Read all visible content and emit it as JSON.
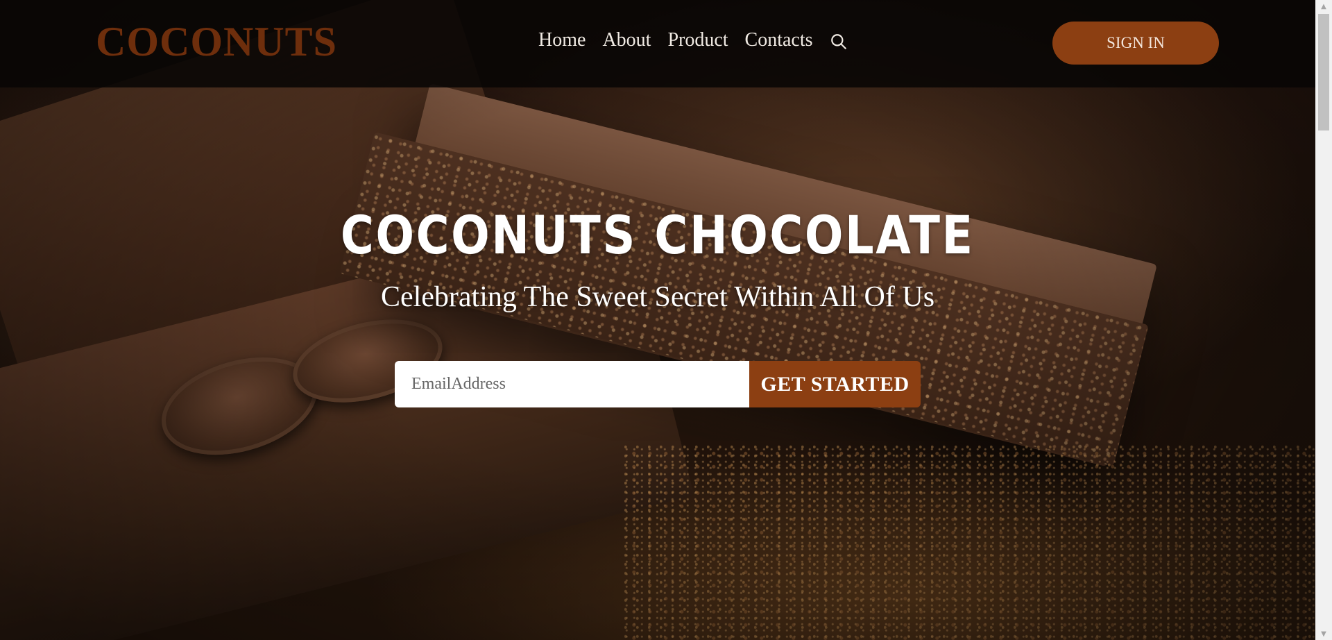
{
  "header": {
    "logo": "COCONUTS",
    "nav": {
      "home": "Home",
      "about": "About",
      "product": "Product",
      "contacts": "Contacts"
    },
    "search_icon": "search-icon",
    "signin_label": "SIGN IN"
  },
  "hero": {
    "title": "COCONUTS CHOCOLATE",
    "subtitle": "Celebrating The Sweet Secret Within All Of Us",
    "email_placeholder": "EmailAddress",
    "cta_label": "GET STARTED"
  },
  "colors": {
    "brand": "#6e2e0c",
    "accent": "#8c3f12",
    "header_bg": "#080604",
    "text_light": "#f1ebe4"
  }
}
